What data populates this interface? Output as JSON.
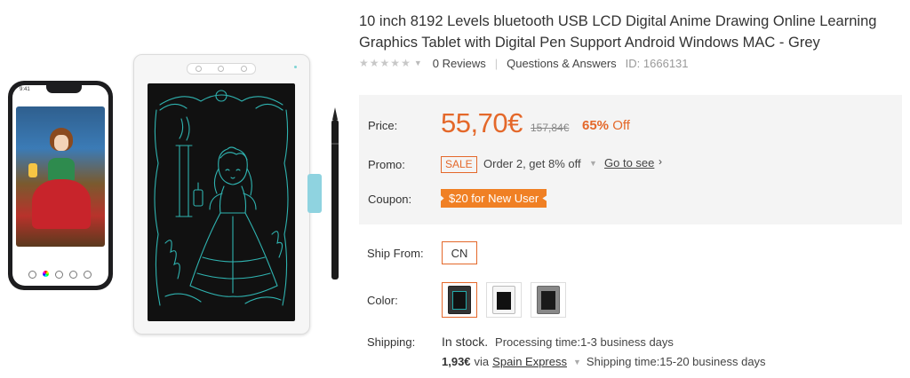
{
  "product": {
    "title": "10 inch 8192 Levels bluetooth USB LCD Digital Anime Drawing Online Learning Graphics Tablet with Digital Pen Support Android Windows MAC - Grey",
    "rating_stars": 0,
    "reviews_label": "0 Reviews",
    "qa_label": "Questions & Answers",
    "id_label": "ID: 1666131",
    "phone_time": "9:41"
  },
  "pricing": {
    "price_label": "Price:",
    "price": "55,70€",
    "old_price": "157,84€",
    "discount_percent": "65%",
    "discount_suffix": "Off",
    "promo_label": "Promo:",
    "promo_badge": "SALE",
    "promo_text": "Order 2, get 8% off",
    "promo_link": "Go to see",
    "coupon_label": "Coupon:",
    "coupon_text": "$20 for New User"
  },
  "options": {
    "ship_from_label": "Ship From:",
    "ship_from_value": "CN",
    "color_label": "Color:",
    "colors": [
      "Dark Tablet",
      "White Tablet",
      "Grey Tablet"
    ],
    "selected_color_index": 0
  },
  "shipping": {
    "label": "Shipping:",
    "stock": "In stock.",
    "processing": "Processing time:1-3 business days",
    "cost": "1,93€",
    "via": "via",
    "method": "Spain Express",
    "shipping_time": "Shipping time:15-20 business days"
  },
  "colors": {
    "accent": "#e4682a",
    "coupon_bg": "#f08024",
    "pricebox_bg": "#f4f4f4",
    "sketch_line": "#2fb3b0"
  }
}
